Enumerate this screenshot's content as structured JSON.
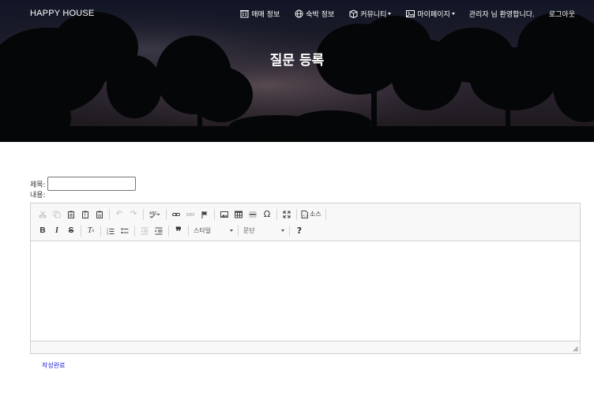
{
  "header": {
    "brand": "HAPPY HOUSE",
    "nav": [
      {
        "label": "매매 정보",
        "icon": "building-icon",
        "dropdown": false
      },
      {
        "label": "숙박 정보",
        "icon": "globe-icon",
        "dropdown": false
      },
      {
        "label": "커뮤니티",
        "icon": "box-icon",
        "dropdown": true
      },
      {
        "label": "마이페이지",
        "icon": "image-icon",
        "dropdown": true
      }
    ],
    "welcome": "관리자 님 환영합니다.",
    "logout": "로그아웃"
  },
  "page_title": "질문 등록",
  "form": {
    "title_label": "제목:",
    "title_value": "",
    "content_label": "내용:",
    "submit_label": "작성완료"
  },
  "editor": {
    "source_label": "소스",
    "style_combo": "스타일",
    "format_combo": "문단",
    "help_label": "?"
  },
  "colors": {
    "link": "#1a1ad6",
    "toolbar_bg": "#f8f8f8",
    "hero_sky": "#1d1d2a"
  }
}
